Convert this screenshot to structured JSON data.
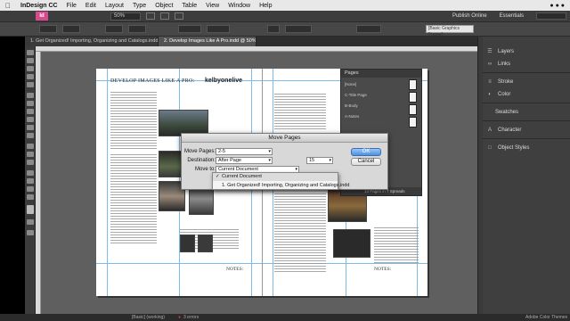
{
  "menubar": {
    "app_name": "InDesign CC",
    "items": [
      "File",
      "Edit",
      "Layout",
      "Type",
      "Object",
      "Table",
      "View",
      "Window",
      "Help"
    ]
  },
  "appbar": {
    "logo": "Id",
    "zoom": "50%",
    "publish_online": "Publish Online",
    "workspace": "Essentials"
  },
  "control": {
    "style_field": "[Basic Graphics Frame]"
  },
  "tabs": [
    "1. Get Organized! Importing, Organizing and Catalogs.indd @ 50%",
    "2. Develop Images Like A Pro.indd @ 50%"
  ],
  "document": {
    "left_title": "DEVELOP IMAGES LIKE A PRO:",
    "logo_text": "kelbyonelive",
    "notes_left": "NOTES:",
    "notes_right": "NOTES:"
  },
  "pages_panel": {
    "title": "Pages",
    "items": [
      "[None]",
      "C-Title Page",
      "B-Body",
      "A-Notes"
    ],
    "footer": "13 Pages in 7 Spreads"
  },
  "right_panels": [
    {
      "label": "Layers",
      "icon": "layers-icon"
    },
    {
      "label": "Links",
      "icon": "links-icon"
    },
    {
      "label": "Stroke",
      "icon": "stroke-icon"
    },
    {
      "label": "Color",
      "icon": "color-icon"
    },
    {
      "label": "Swatches",
      "icon": "swatches-icon"
    },
    {
      "label": "Character",
      "icon": "character-icon"
    },
    {
      "label": "Object Styles",
      "icon": "object-styles-icon"
    }
  ],
  "dialog": {
    "title": "Move Pages",
    "move_pages_label": "Move Pages:",
    "move_pages_value": "2-5",
    "destination_label": "Destination:",
    "destination_value": "After Page",
    "page_value": "15",
    "move_to_label": "Move to:",
    "move_to_value": "Current Document",
    "ok_label": "OK",
    "cancel_label": "Cancel"
  },
  "dropdown": {
    "options": [
      "Current Document",
      "1. Get Organized! Importing, Organizing and Catalogs.indd"
    ],
    "checked_index": 0
  },
  "status": {
    "style": "[Basic] (working)",
    "errors": "3 errors",
    "bottom_right": "Adobe Color Themes"
  }
}
